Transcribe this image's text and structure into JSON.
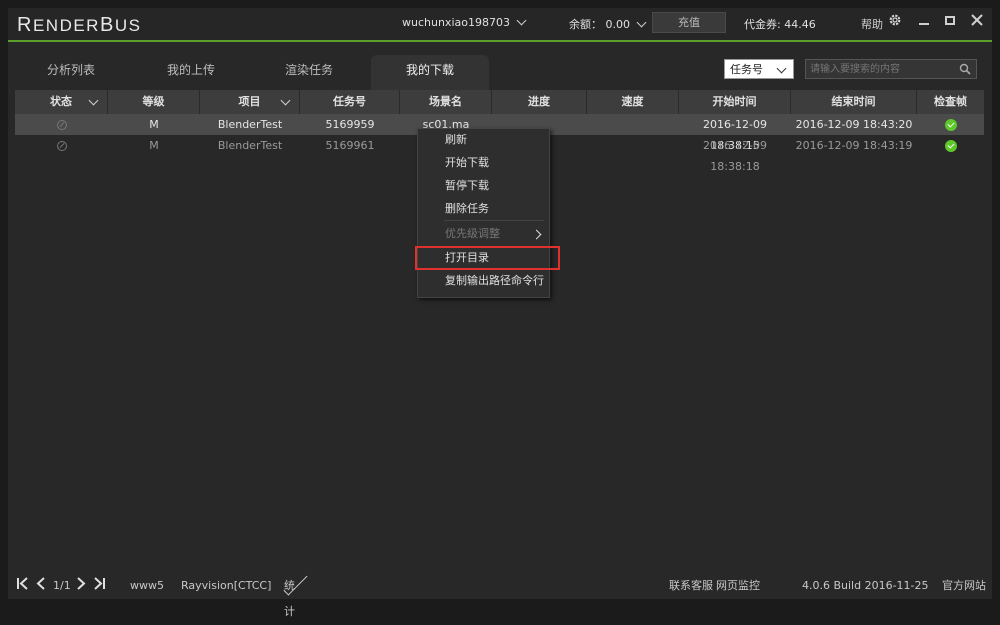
{
  "app": {
    "logo_prefix": "R",
    "logo_main": "ENDER",
    "logo_prefix2": "B",
    "logo_main2": "US"
  },
  "header": {
    "username": "wuchunxiao198703",
    "balance_label": "余额：",
    "balance_value": "0.00",
    "recharge_label": "充值",
    "voucher_label": "代金券:",
    "voucher_value": "44.46",
    "help_label": "帮助",
    "icons": [
      "gear-icon",
      "minimize-icon",
      "maximize-icon",
      "close-icon"
    ]
  },
  "tabs": [
    {
      "label": "分析列表",
      "active": false
    },
    {
      "label": "我的上传",
      "active": false
    },
    {
      "label": "渲染任务",
      "active": false
    },
    {
      "label": "我的下载",
      "active": true
    }
  ],
  "search": {
    "filter_value": "任务号",
    "placeholder": "请输入要搜索的内容"
  },
  "table": {
    "columns": [
      "状态",
      "等级",
      "项目",
      "任务号",
      "场景名",
      "进度",
      "速度",
      "开始时间",
      "结束时间",
      "检查帧"
    ],
    "rows": [
      {
        "level": "M",
        "project": "BlenderTest",
        "task_id": "5169959",
        "scene": "sc01.ma",
        "progress": "",
        "speed": "",
        "start": "2016-12-09 18:38:15",
        "end": "2016-12-09 18:43:20"
      },
      {
        "level": "M",
        "project": "BlenderTest",
        "task_id": "5169961",
        "scene": "",
        "progress": "",
        "speed": "",
        "start": "2016-12-09 18:38:18",
        "end": "2016-12-09 18:43:19"
      }
    ]
  },
  "context_menu": {
    "items": [
      {
        "label": "刷新",
        "disabled": false
      },
      {
        "label": "开始下载",
        "disabled": false
      },
      {
        "label": "暂停下载",
        "disabled": false
      },
      {
        "label": "删除任务",
        "disabled": false
      },
      {
        "label": "优先级调整",
        "disabled": true
      },
      {
        "label": "打开目录",
        "disabled": false
      },
      {
        "label": "复制输出路径命令行",
        "disabled": false
      }
    ]
  },
  "footer": {
    "page": "1/1",
    "server": "www5",
    "network": "Rayvision[CTCC]",
    "stats_label": "统计",
    "support": "联系客服",
    "monitor": "网页监控",
    "version": "4.0.6 Build 2016-11-25",
    "website": "官方网站"
  },
  "colors": {
    "accent": "#5aa02c",
    "check_green": "#5ec72a",
    "highlight_red": "#e03030"
  }
}
